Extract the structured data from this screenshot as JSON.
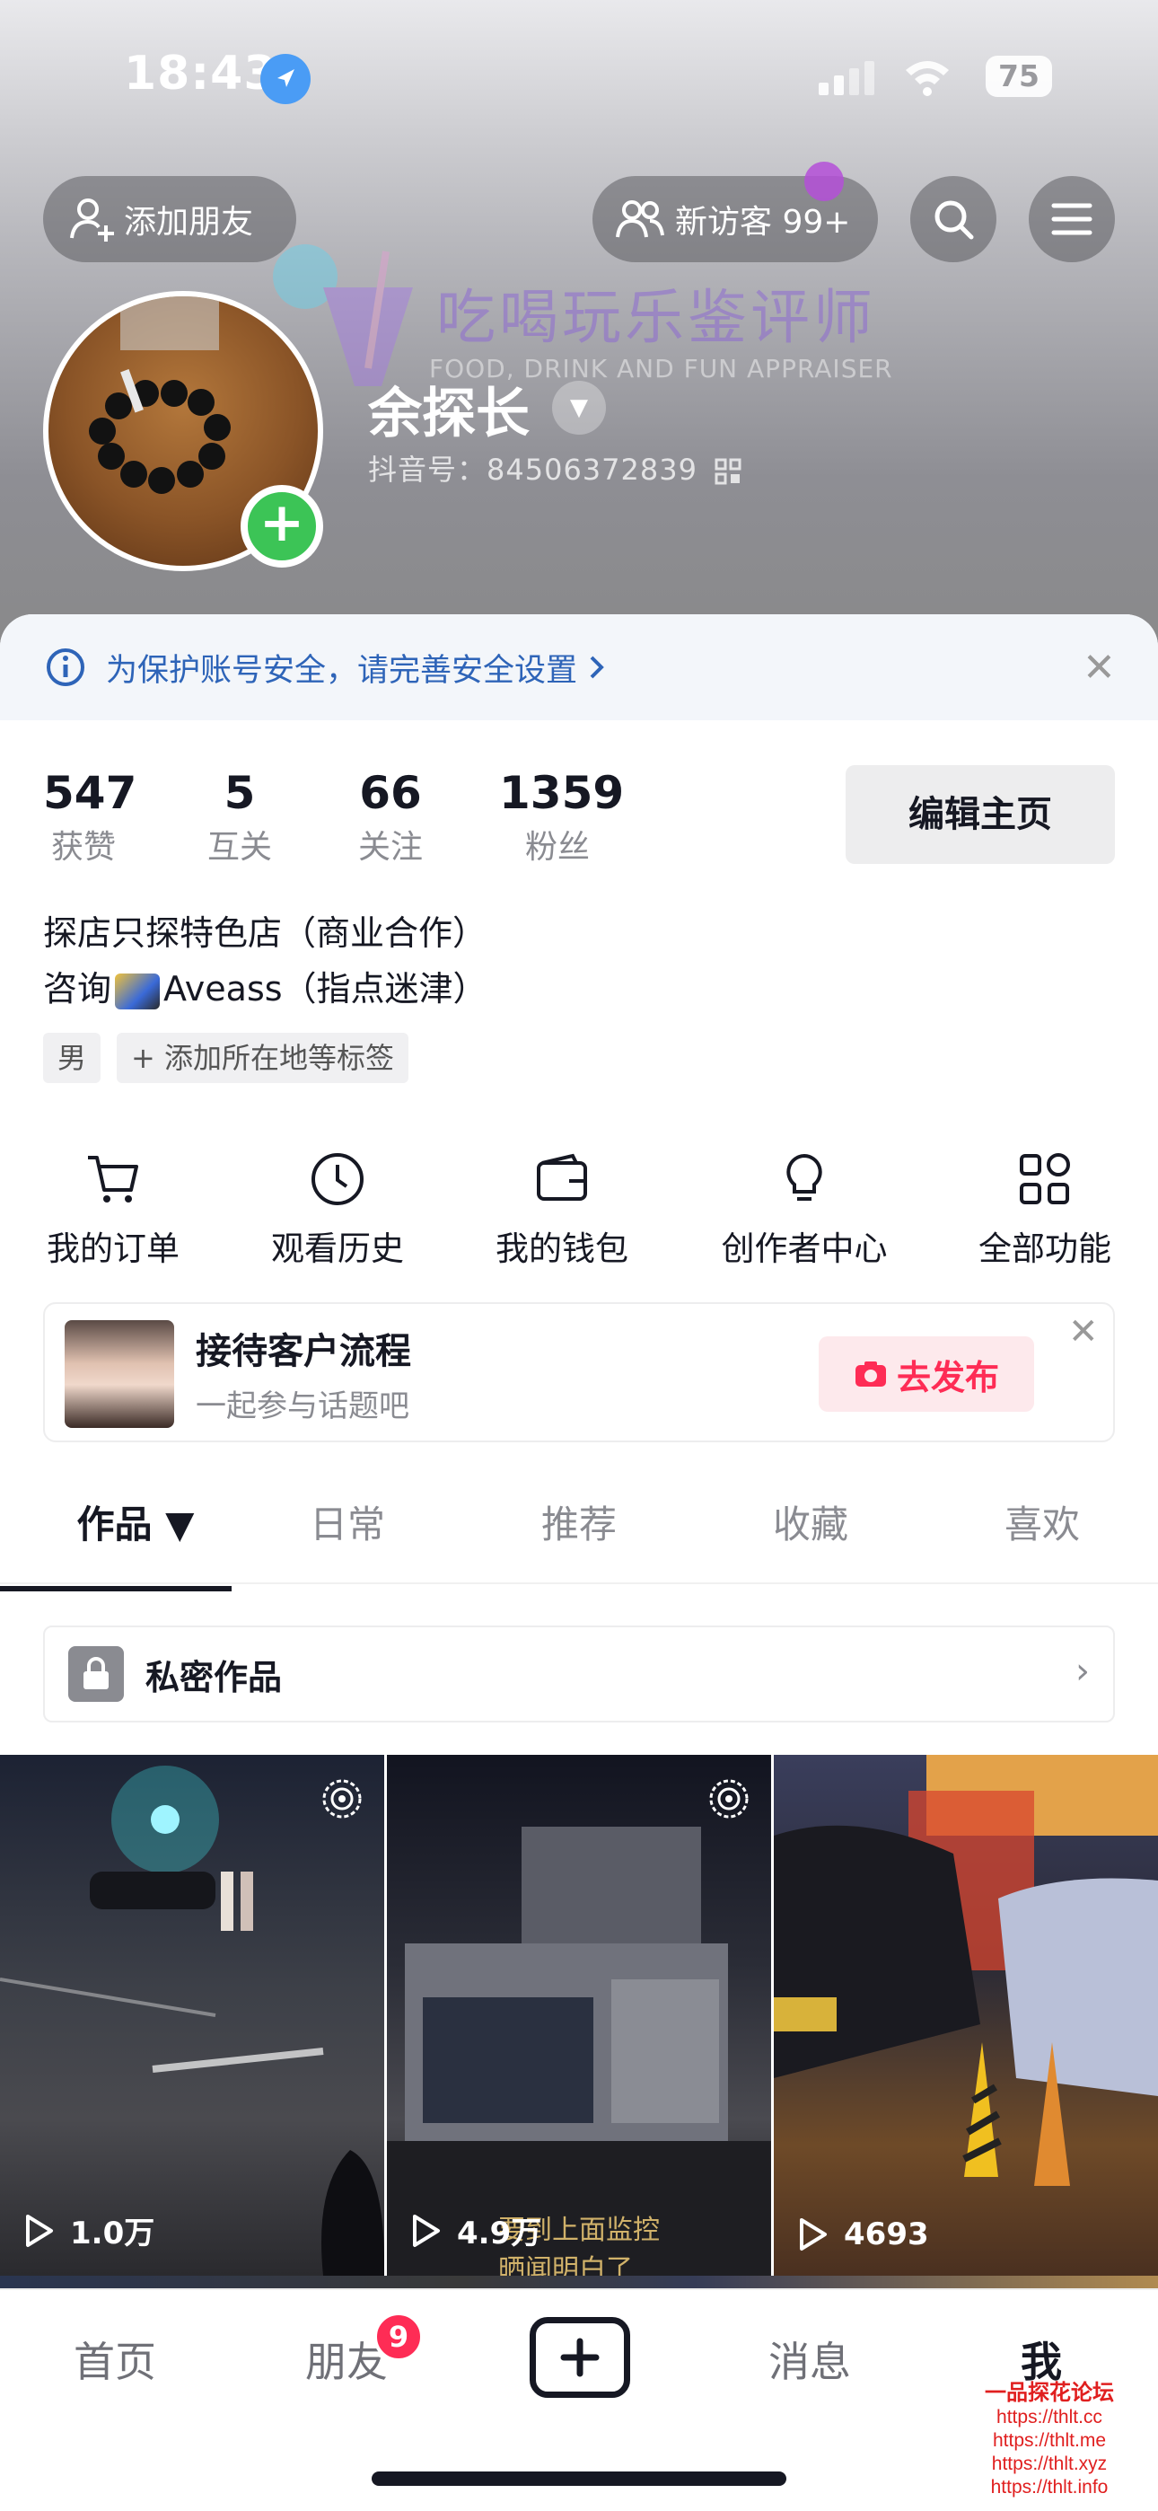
{
  "status": {
    "time": "18:43",
    "battery": "75"
  },
  "header": {
    "add_friend": "添加朋友",
    "visitors": "新访客 99+",
    "watermark_cn": "吃喝玩乐鉴评师",
    "watermark_en": "FOOD, DRINK AND FUN APPRAISER",
    "name": "余探长",
    "douyin_id": "抖音号：84506372839"
  },
  "security": {
    "text": "为保护账号安全，请完善安全设置"
  },
  "stats": [
    {
      "num": "547",
      "label": "获赞"
    },
    {
      "num": "5",
      "label": "互关"
    },
    {
      "num": "66",
      "label": "关注"
    },
    {
      "num": "1359",
      "label": "粉丝"
    }
  ],
  "edit_button": "编辑主页",
  "bio": {
    "line1": "探店只探特色店（商业合作）",
    "line2_pre": "咨询",
    "line2_post": "Aveass（指点迷津）"
  },
  "tags": {
    "gender": "男",
    "add_location": "+ 添加所在地等标签"
  },
  "functions": [
    "我的订单",
    "观看历史",
    "我的钱包",
    "创作者中心",
    "全部功能"
  ],
  "promo": {
    "title": "接待客户流程",
    "subtitle": "一起参与话题吧",
    "button": "去发布"
  },
  "tabs": [
    "作品 ▼",
    "日常",
    "推荐",
    "收藏",
    "喜欢"
  ],
  "private_works": "私密作品",
  "videos": [
    {
      "plays": "1.0万"
    },
    {
      "plays": "4.9万",
      "overlay": "要到上面监控\n晒闻明白了"
    },
    {
      "plays": "4693"
    }
  ],
  "navbar": {
    "home": "首页",
    "friends": "朋友",
    "friends_badge": "9",
    "messages": "消息",
    "me": "我"
  },
  "forum": {
    "title": "一品探花论坛",
    "urls": [
      "https://thlt.cc",
      "https://thlt.me",
      "https://thlt.xyz",
      "https://thlt.info"
    ]
  },
  "colors": {
    "accent": "#fe2c55",
    "link": "#2e64b8",
    "green": "#3cc456"
  }
}
